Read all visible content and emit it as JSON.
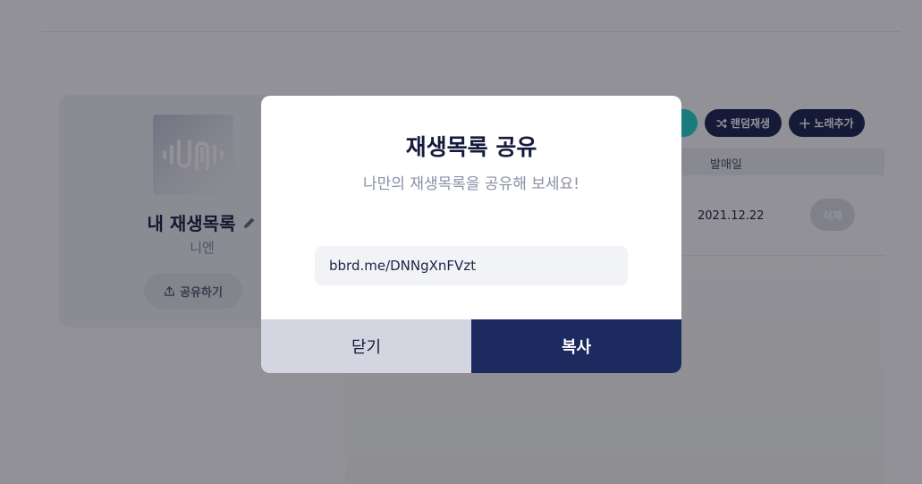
{
  "playlist": {
    "title": "내 재생목록",
    "owner": "니엔",
    "share_label": "공유하기"
  },
  "toolbar": {
    "shuffle_label": "랜덤재생",
    "add_song_label": "노래추가"
  },
  "table": {
    "columns": [
      "발매일"
    ],
    "rows": [
      {
        "release_date": "2021.12.22",
        "delete_label": "삭제"
      }
    ]
  },
  "modal": {
    "title": "재생목록 공유",
    "subtitle": "나만의 재생목록을 공유해 보세요!",
    "share_url": "bbrd.me/DNNgXnFVzt",
    "close_label": "닫기",
    "copy_label": "복사"
  },
  "colors": {
    "accent_navy": "#1d2a60",
    "accent_teal": "#26d7d0",
    "overlay": "rgba(10,12,24,0.45)"
  },
  "icons": {
    "cover": "waveform-logo-icon",
    "edit": "pencil-icon",
    "share": "upload-icon",
    "shuffle": "shuffle-icon",
    "add": "plus-icon"
  }
}
